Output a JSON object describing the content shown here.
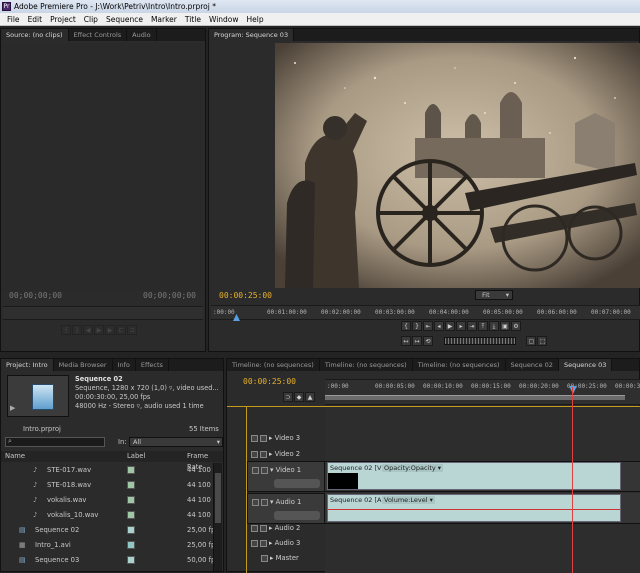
{
  "window": {
    "title": "Adobe Premiere Pro - J:\\Work\\Petriv\\Intro\\Intro.prproj *"
  },
  "menu": [
    "File",
    "Edit",
    "Project",
    "Clip",
    "Sequence",
    "Marker",
    "Title",
    "Window",
    "Help"
  ],
  "source_panel": {
    "tabs": [
      "Source: (no clips)",
      "Effect Controls",
      "Audio"
    ],
    "timecode_in": "00;00;00;00",
    "timecode_out": "00;00;00;00"
  },
  "program_panel": {
    "tab": "Program: Sequence 03",
    "timecode": "00:00:25:00",
    "zoom": "Fit",
    "ruler_ticks": [
      ":00:00",
      "00:01:00:00",
      "00:02:00:00",
      "00:03:00:00",
      "00:04:00:00",
      "00:05:00:00",
      "00:06:00:00",
      "00:07:00:00",
      "00:0"
    ]
  },
  "project_panel": {
    "tabs": [
      "Project: Intro",
      "Media Browser",
      "Info",
      "Effects"
    ],
    "selected_name": "Sequence 02",
    "selected_info1": "Sequence, 1280 x 720 (1,0)  ▿, video used...",
    "selected_info2": "00:00:30:00, 25,00 fps",
    "selected_info3": "48000 Hz - Stereo  ▿, audio used 1 time",
    "project_file": "Intro.prproj",
    "item_count": "55 Items",
    "in_label": "In:",
    "in_value": "All",
    "columns": {
      "name": "Name",
      "label": "Label",
      "frame_rate": "Frame Rate"
    },
    "items": [
      {
        "name": "STE-017.wav",
        "rate": "44 100 H",
        "type": "audio"
      },
      {
        "name": "STE-018.wav",
        "rate": "44 100 H",
        "type": "audio"
      },
      {
        "name": "vokalis.wav",
        "rate": "44 100 H",
        "type": "audio"
      },
      {
        "name": "vokalis_10.wav",
        "rate": "44 100 H",
        "type": "audio"
      },
      {
        "name": "Sequence 02",
        "rate": "25,00 fp",
        "type": "sequence"
      },
      {
        "name": "Intro_1.avi",
        "rate": "25,00 fp",
        "type": "video"
      },
      {
        "name": "Sequence 03",
        "rate": "50,00 fp",
        "type": "sequence"
      }
    ]
  },
  "timeline": {
    "tabs": [
      "Timeline: (no sequences)",
      "Timeline: (no sequences)",
      "Timeline: (no sequences)",
      "Sequence 02",
      "Sequence 03"
    ],
    "timecode": "00:00:25:00",
    "ruler_ticks": [
      ":00:00",
      "00:00:05:00",
      "00:00:10:00",
      "00:00:15:00",
      "00:00:20:00",
      "00:00:25:00",
      "00:00:30:00"
    ],
    "tracks": [
      "Video 3",
      "Video 2",
      "Video 1",
      "Audio 1",
      "Audio 2",
      "Audio 3",
      "Master"
    ],
    "video_clip": "Sequence 02 [V]",
    "video_clip_fx": "Opacity:Opacity ▾",
    "audio_clip": "Sequence 02 [A]",
    "audio_clip_fx": "Volume:Level ▾"
  }
}
